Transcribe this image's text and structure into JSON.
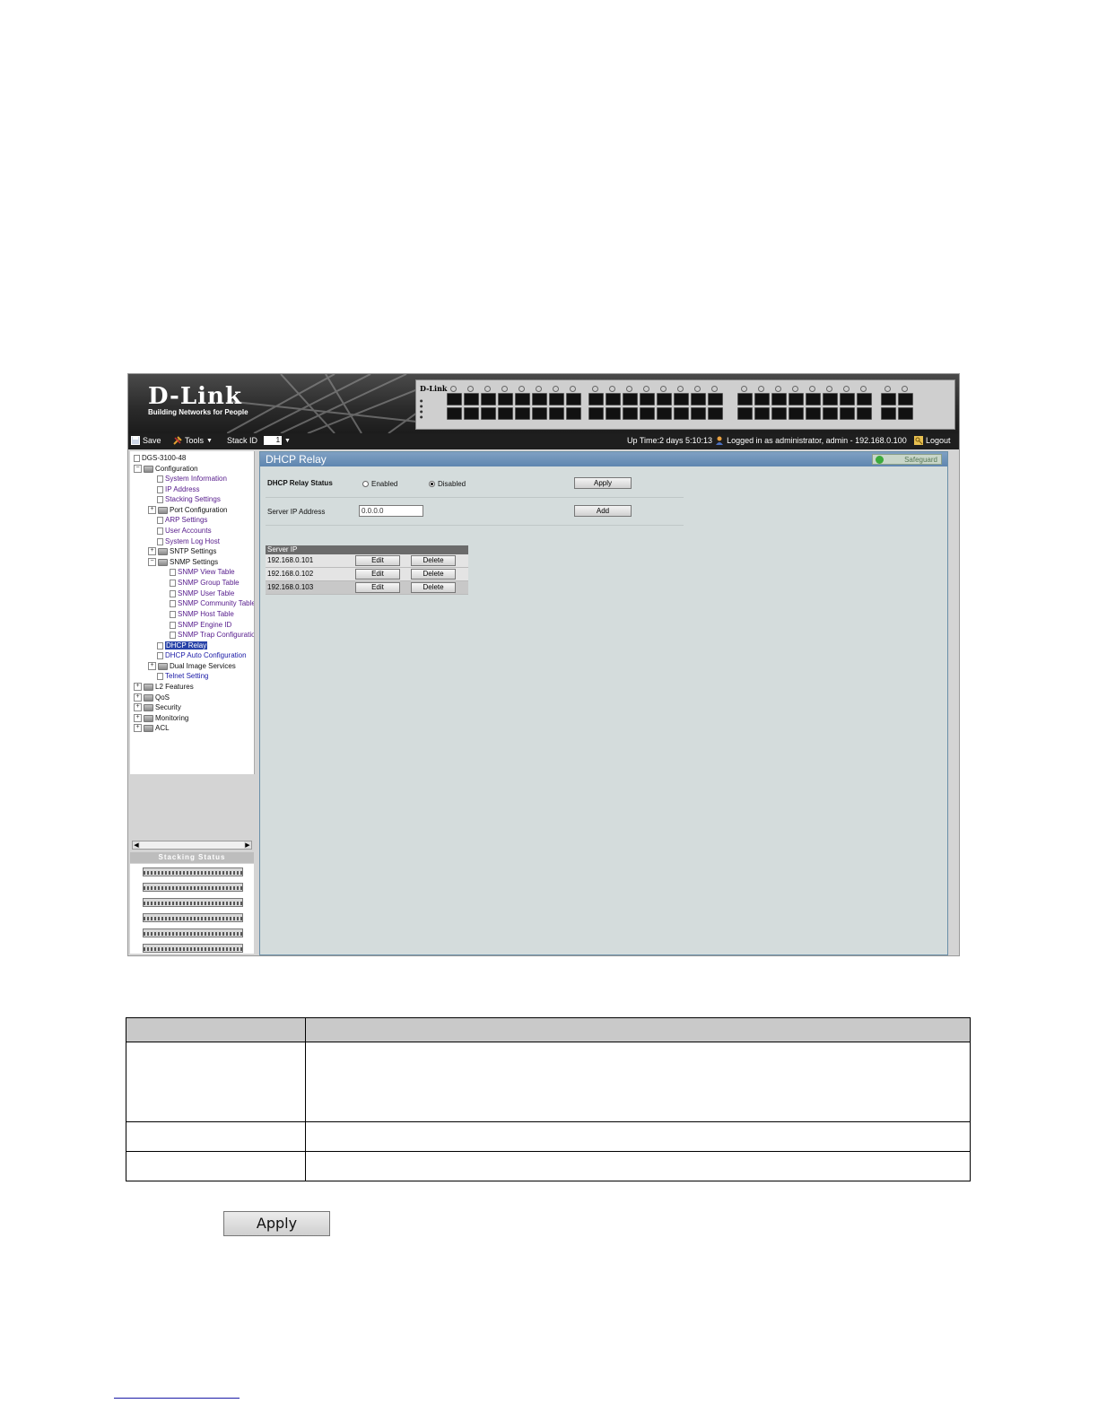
{
  "brand": {
    "logo": "D-Link",
    "tagline": "Building Networks for People"
  },
  "toolbar": {
    "save_label": "Save",
    "tools_label": "Tools",
    "stack_id_label": "Stack ID",
    "stack_id_value": "1",
    "uptime": "Up Time:2 days 5:10:13",
    "login_info": "Logged in as administrator, admin - 192.168.0.100",
    "logout_label": "Logout"
  },
  "tree": {
    "root": "DGS-3100-48",
    "configuration": "Configuration",
    "items": {
      "system_information": "System Information",
      "ip_address": "IP Address",
      "stacking_settings": "Stacking Settings",
      "port_configuration": "Port Configuration",
      "arp_settings": "ARP Settings",
      "user_accounts": "User Accounts",
      "system_log_host": "System Log Host",
      "sntp_settings": "SNTP Settings",
      "snmp_settings": "SNMP Settings",
      "snmp_view_table": "SNMP View Table",
      "snmp_group_table": "SNMP Group Table",
      "snmp_user_table": "SNMP User Table",
      "snmp_community_table": "SNMP Community Table",
      "snmp_host_table": "SNMP Host Table",
      "snmp_engine_id": "SNMP Engine ID",
      "snmp_trap_configuration": "SNMP Trap Configuration",
      "dhcp_relay": "DHCP Relay",
      "dhcp_auto_configuration": "DHCP Auto Configuration",
      "dual_image_services": "Dual Image Services",
      "telnet_setting": "Telnet Setting",
      "l2_features": "L2 Features",
      "qos": "QoS",
      "security": "Security",
      "monitoring": "Monitoring",
      "acl": "ACL"
    }
  },
  "stacking_status": {
    "title": "Stacking Status"
  },
  "content": {
    "title": "DHCP Relay",
    "safeguard": "Safeguard",
    "relay_status_label": "DHCP Relay Status",
    "enabled_label": "Enabled",
    "disabled_label": "Disabled",
    "selected": "Disabled",
    "apply_label": "Apply",
    "server_ip_label": "Server IP Address",
    "server_ip_value": "0.0.0.0",
    "add_label": "Add",
    "table": {
      "header": "Server IP",
      "rows": [
        {
          "ip": "192.168.0.101",
          "edit": "Edit",
          "delete": "Delete"
        },
        {
          "ip": "192.168.0.102",
          "edit": "Edit",
          "delete": "Delete"
        },
        {
          "ip": "192.168.0.103",
          "edit": "Edit",
          "delete": "Delete"
        }
      ]
    }
  },
  "doc": {
    "apply_button_label": "Apply"
  },
  "colors": {
    "content_title": "#5f86b0",
    "selected_node": "#2742a8",
    "link": "#551a8b"
  }
}
